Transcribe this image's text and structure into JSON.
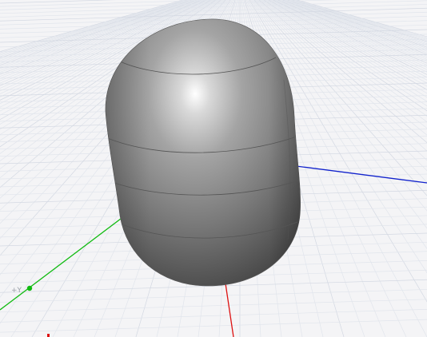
{
  "viewport": {
    "background": "#f4f4f6",
    "grid_color": "#d3d8e2",
    "grid_color_minor": "#e1e5ec",
    "axis_colors": {
      "x": "#dd1111",
      "y": "#11bb11",
      "z": "#1122cc"
    },
    "origin_marker_icon": "origin-dot-icon",
    "axis_label_visible": "+Y"
  },
  "scene": {
    "object": "capsule",
    "shading": "smooth-gray",
    "body_color": "#8a8a8a",
    "highlight_color": "#ffffff",
    "seam_color": "#555555",
    "rendering_mode": "perspective"
  }
}
